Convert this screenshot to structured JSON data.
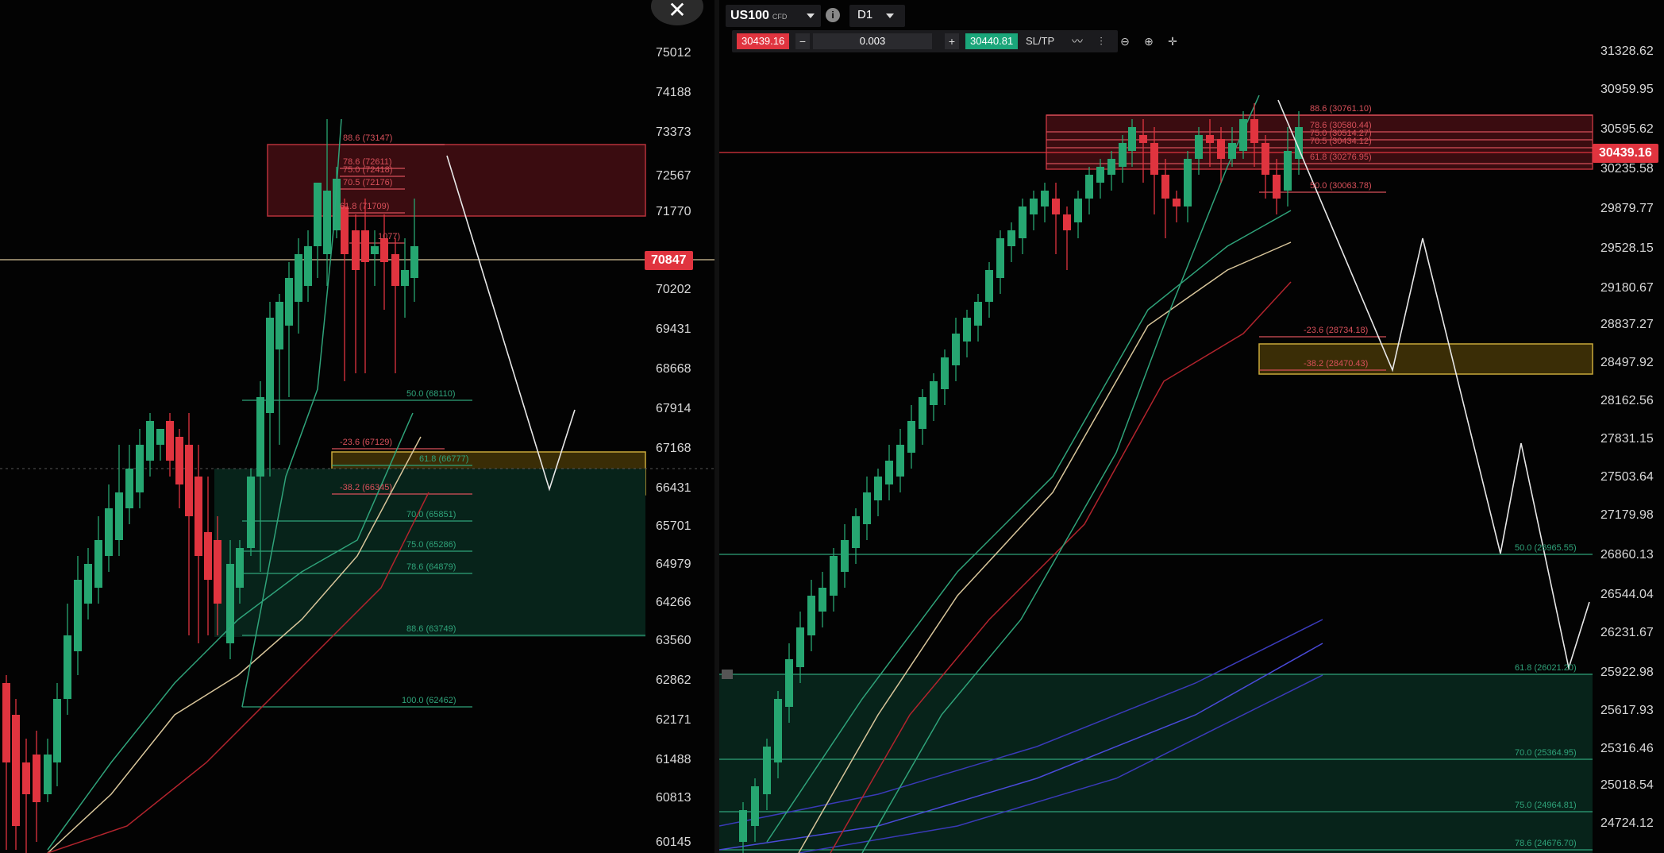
{
  "left_chart": {
    "close_label": "✕",
    "current_price": "70847",
    "price_axis": [
      "75012",
      "74188",
      "73373",
      "72567",
      "71770",
      "70202",
      "69431",
      "68668",
      "67914",
      "67168",
      "66431",
      "65701",
      "64979",
      "64266",
      "63560",
      "62862",
      "62171",
      "61488",
      "60813",
      "60145"
    ],
    "fib_levels": [
      {
        "label": "88.6 (73147)",
        "type": "red"
      },
      {
        "label": "78.6 (72611)",
        "type": "red"
      },
      {
        "label": "75.0 (72418)",
        "type": "red"
      },
      {
        "label": "70.5 (72176)",
        "type": "red"
      },
      {
        "label": "61.8 (71709)",
        "type": "red"
      },
      {
        "label": "1077)",
        "type": "red"
      },
      {
        "label": "50.0 (68110)",
        "type": "green"
      },
      {
        "label": "-23.6 (67129)",
        "type": "red"
      },
      {
        "label": "61.8 (66777)",
        "type": "green"
      },
      {
        "label": "-38.2 (66345)",
        "type": "red"
      },
      {
        "label": "70.0 (65851)",
        "type": "green"
      },
      {
        "label": "75.0 (65286)",
        "type": "green"
      },
      {
        "label": "78.6 (64879)",
        "type": "green"
      },
      {
        "label": "88.6 (63749)",
        "type": "green"
      },
      {
        "label": "100.0 (62462)",
        "type": "green"
      }
    ]
  },
  "right_chart": {
    "toolbar": {
      "symbol": "US100",
      "symbol_badge": "CFD",
      "info_icon": "i",
      "timeframe": "D1",
      "bid": "30439.16",
      "minus": "−",
      "quantity": "0.003",
      "plus": "+",
      "ask": "30440.81",
      "sltp": "SL/TP"
    },
    "current_price": "30439.16",
    "price_axis": [
      "31328.62",
      "30959.95",
      "30595.62",
      "30235.58",
      "29879.77",
      "29528.15",
      "29180.67",
      "28837.27",
      "28497.92",
      "28162.56",
      "27831.15",
      "27503.64",
      "27179.98",
      "26860.13",
      "26544.04",
      "26231.67",
      "25922.98",
      "25617.93",
      "25316.46",
      "25018.54",
      "24724.12"
    ],
    "fib_levels": [
      {
        "label": "88.6 (30761.10)",
        "type": "red"
      },
      {
        "label": "78.6 (30580.44)",
        "type": "red"
      },
      {
        "label": "75.0 (30514.27)",
        "type": "red"
      },
      {
        "label": "70.5 (30434.12)",
        "type": "red"
      },
      {
        "label": "61.8 (30276.95)",
        "type": "red"
      },
      {
        "label": "50.0 (30063.78)",
        "type": "red"
      },
      {
        "label": "-23.6 (28734.18)",
        "type": "red"
      },
      {
        "label": "-38.2 (28470.43)",
        "type": "red"
      },
      {
        "label": "50.0 (26965.55)",
        "type": "green"
      },
      {
        "label": "61.8 (26021.20)",
        "type": "green"
      },
      {
        "label": "70.0 (25364.95)",
        "type": "green"
      },
      {
        "label": "75.0 (24964.81)",
        "type": "green"
      },
      {
        "label": "78.6 (24676.70)",
        "type": "green"
      }
    ]
  },
  "colors": {
    "up": "#26a671",
    "down": "#e0343f",
    "fib_red": "#d8505a",
    "fib_green": "#2fa37a",
    "zone_yellow": "#c9a93a",
    "projection": "#e8e8e8"
  }
}
